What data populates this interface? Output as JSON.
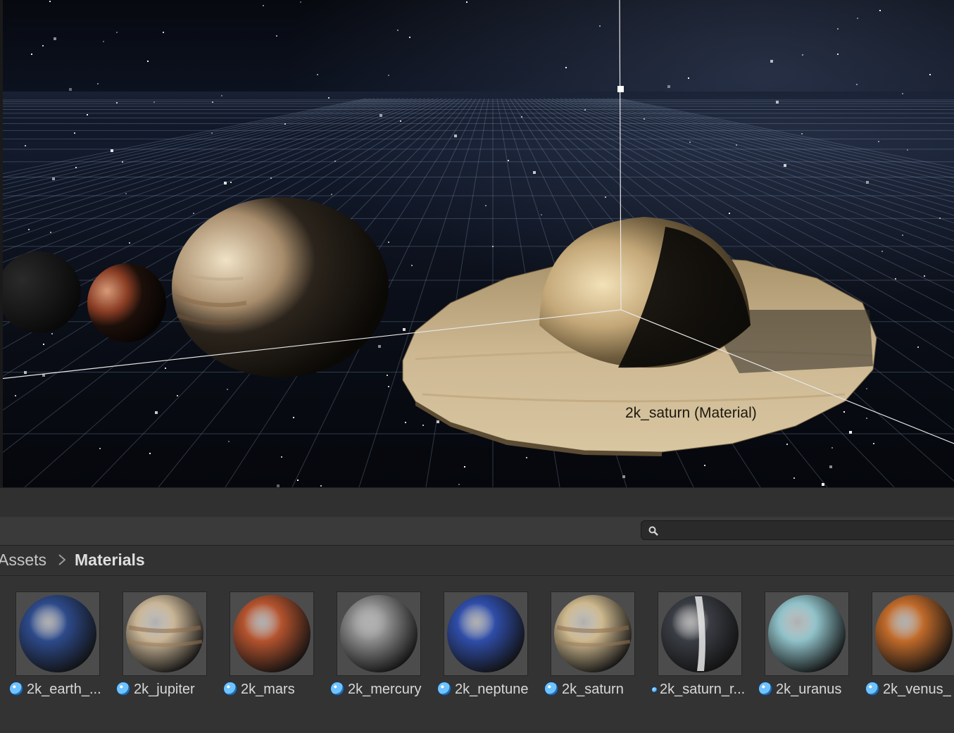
{
  "scene": {
    "hover_label": "2k_saturn (Material)"
  },
  "project": {
    "search": {
      "value": "",
      "placeholder": ""
    },
    "breadcrumb": {
      "root": "Assets",
      "current": "Materials"
    },
    "assets": [
      {
        "label": "2k_earth_...",
        "icon": "material-icon",
        "color": "#2d4a8a"
      },
      {
        "label": "2k_jupiter",
        "icon": "material-icon",
        "color": "#c9b596"
      },
      {
        "label": "2k_mars",
        "icon": "material-icon",
        "color": "#b4532e"
      },
      {
        "label": "2k_mercury",
        "icon": "material-icon",
        "color": "#8a8a8a"
      },
      {
        "label": "2k_neptune",
        "icon": "material-icon",
        "color": "#2f4da8"
      },
      {
        "label": "2k_saturn",
        "icon": "material-icon",
        "color": "#cdb88e"
      },
      {
        "label": "2k_saturn_r...",
        "icon": "material-icon-small",
        "color": "#3a3d44"
      },
      {
        "label": "2k_uranus",
        "icon": "material-icon",
        "color": "#8fc1c8"
      },
      {
        "label": "2k_venus_",
        "icon": "material-icon",
        "color": "#c06a2a"
      }
    ]
  }
}
